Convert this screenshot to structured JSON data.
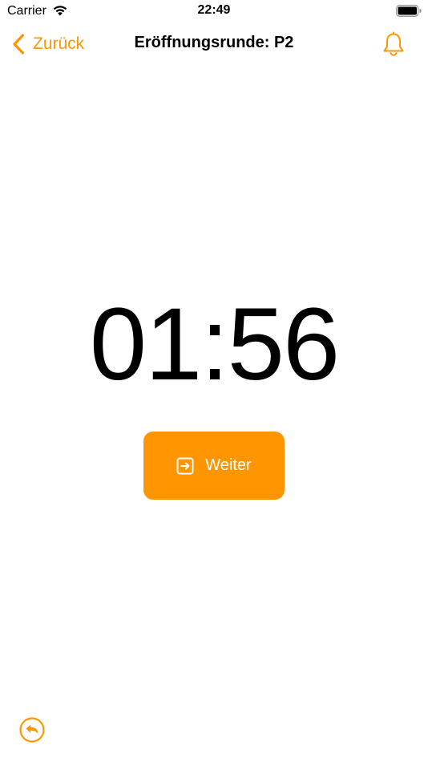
{
  "status_bar": {
    "carrier": "Carrier",
    "time": "22:49"
  },
  "nav": {
    "back_label": "Zurück",
    "title": "Eröffnungsrunde: P2",
    "bell_icon": "bell-icon"
  },
  "timer": {
    "display": "01:56"
  },
  "weiter_button": {
    "label": "Weiter",
    "icon": "arrow-right-square-icon"
  },
  "bottom": {
    "undo_icon": "arrow-uturn-left-circle-icon"
  },
  "colors": {
    "accent": "#ff9500",
    "text": "#000000",
    "background": "#ffffff"
  }
}
